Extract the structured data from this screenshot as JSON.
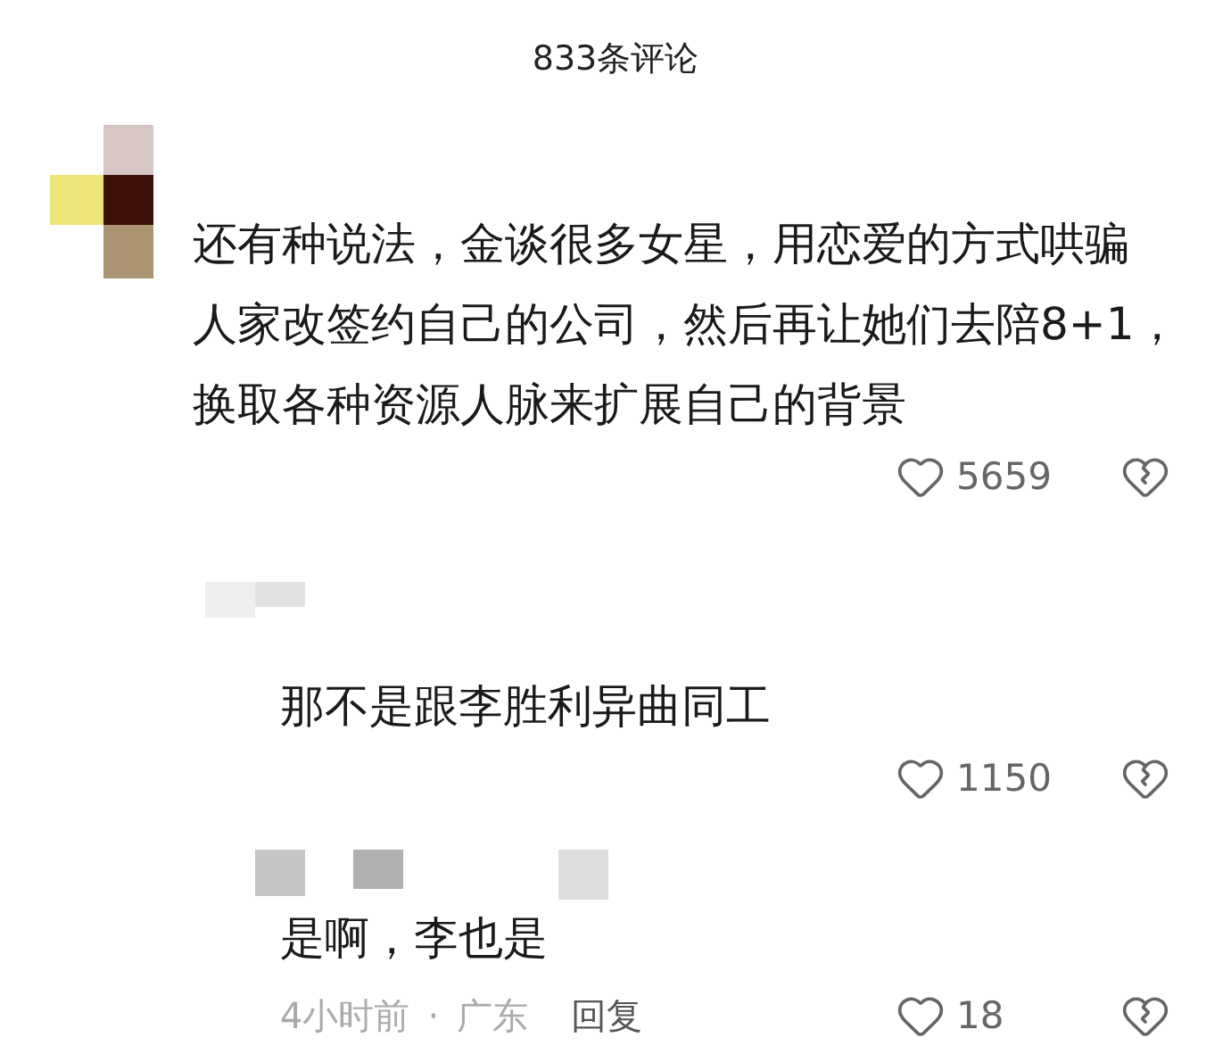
{
  "title": "833条评论",
  "comments": [
    {
      "kind": "comment",
      "lines": [
        "还有种说法，金谈很多女星，用恋爱的方式哄骗",
        "人家改签约自己的公司，然后再让她们去陪8+1，",
        "换取各种资源人脉来扩展自己的背景"
      ],
      "likes": "5659"
    },
    {
      "kind": "reply",
      "lines": [
        "那不是跟李胜利异曲同工"
      ],
      "likes": "1150"
    },
    {
      "kind": "reply",
      "lines": [
        "是啊，李也是"
      ],
      "time": "4小时前",
      "separator": "·",
      "location": "广东",
      "reply": "回复",
      "likes": "18"
    }
  ]
}
